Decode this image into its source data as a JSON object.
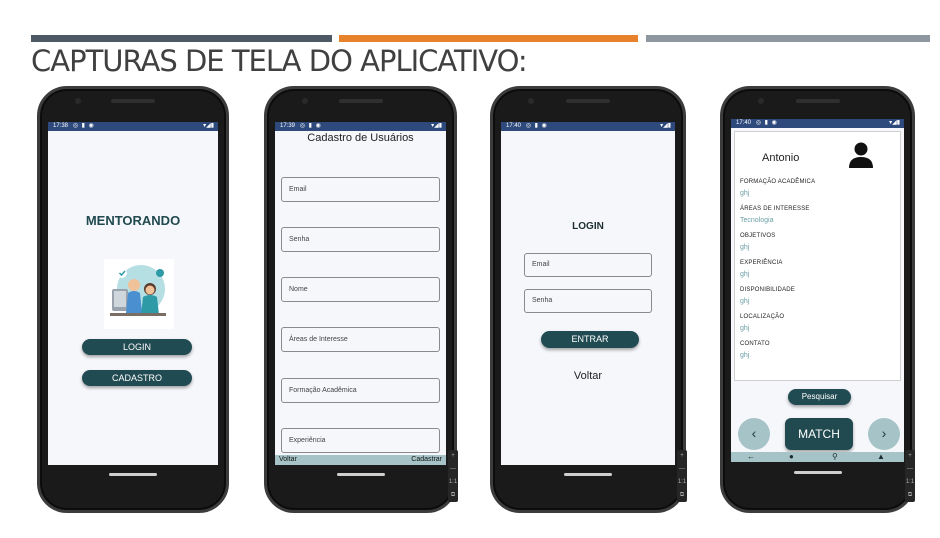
{
  "slide": {
    "title": "CAPTURAS DE TELA DO APLICATIVO:"
  },
  "phones": [
    {
      "time": "17:38",
      "app_title": "MENTORANDO",
      "buttons": [
        "LOGIN",
        "CADASTRO"
      ]
    },
    {
      "time": "17:39",
      "title": "Cadastro de Usuários",
      "fields": [
        "Email",
        "Senha",
        "Nome",
        "Áreas de Interesse",
        "Formação Acadêmica",
        "Experiência"
      ],
      "footer_left": "Voltar",
      "footer_right": "Cadastrar"
    },
    {
      "time": "17:40",
      "title": "LOGIN",
      "fields": [
        "Email",
        "Senha"
      ],
      "button": "ENTRAR",
      "back": "Voltar"
    },
    {
      "time": "17:40",
      "name": "Antonio",
      "sections": [
        {
          "label": "FORMAÇÃO ACADÊMICA",
          "value": "ghj"
        },
        {
          "label": "ÁREAS DE INTERESSE",
          "value": "Tecnologia"
        },
        {
          "label": "OBJETIVOS",
          "value": "ghj"
        },
        {
          "label": "EXPERIÊNCIA",
          "value": "ghj"
        },
        {
          "label": "DISPONIBILIDADE",
          "value": "ghj"
        },
        {
          "label": "LOCALIZAÇÃO",
          "value": "ghj"
        },
        {
          "label": "CONTATO",
          "value": "ghj"
        }
      ],
      "search_button": "Pesquisar",
      "match_button": "MATCH",
      "prev_icon": "‹",
      "next_icon": "›"
    }
  ],
  "side_tools": [
    "+",
    "—",
    "1:1",
    "⧉"
  ],
  "colors": {
    "accent": "#214b52",
    "status_bar": "#2e4a7d",
    "footer": "#a6c4c8",
    "value_text": "#6b9ea5"
  }
}
